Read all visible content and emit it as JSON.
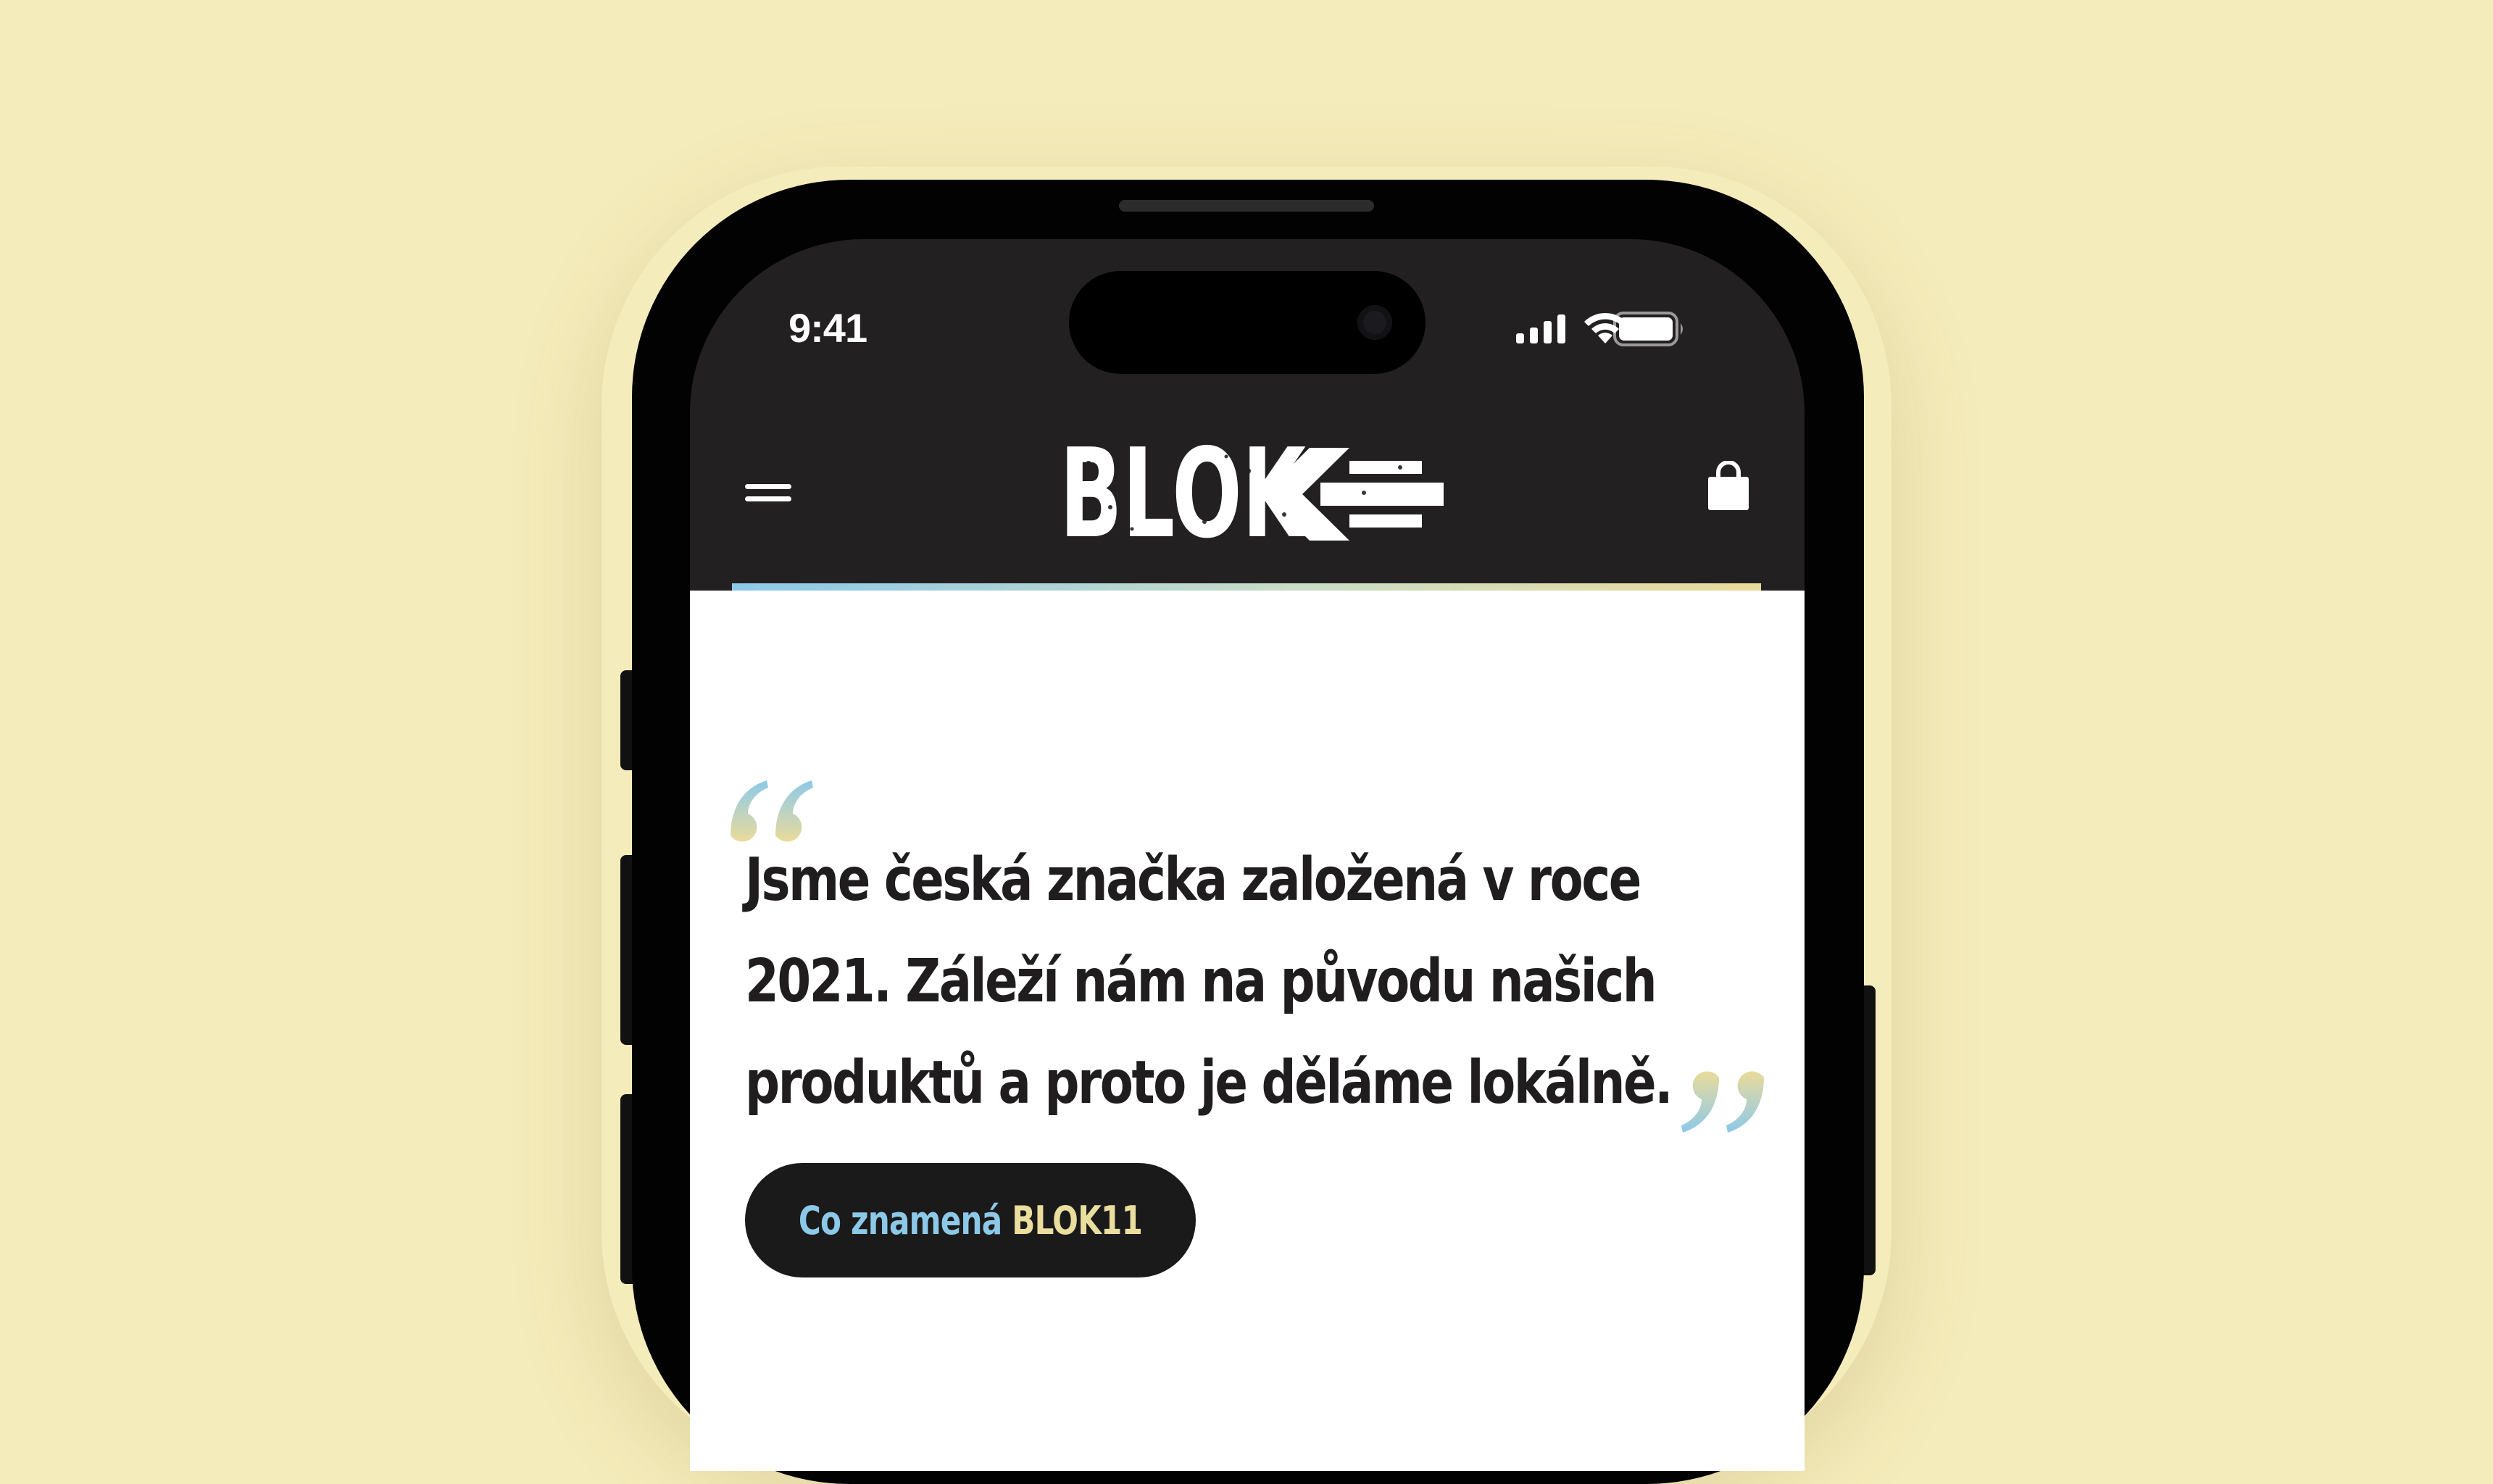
{
  "status_bar": {
    "time": "9:41",
    "icons": [
      "cellular-signal-icon",
      "wifi-icon",
      "battery-icon"
    ]
  },
  "header": {
    "menu_icon": "hamburger-menu-icon",
    "logo_text": "BLOK",
    "cart_icon": "shopping-bag-icon"
  },
  "quote": {
    "lines": [
      "Jsme česká značka založená v roce",
      "2021. Záleží nám na původu našich",
      "produktů a proto je děláme lokálně."
    ]
  },
  "cta": {
    "label_part1": "Co znamená",
    "label_part2": "BLOK11"
  },
  "colors": {
    "background": "#f5ecbb",
    "header_bg": "#232021",
    "accent_blue": "#8cc9e9",
    "accent_yellow": "#e9de9e",
    "text_dark": "#1f1d1e"
  }
}
